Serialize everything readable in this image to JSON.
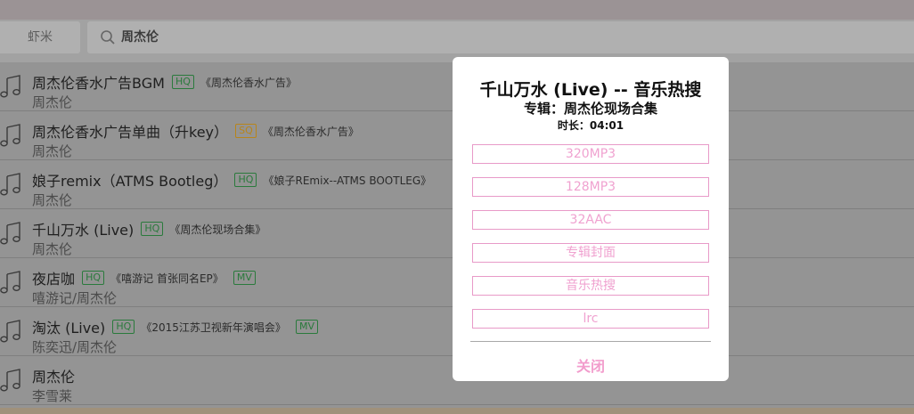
{
  "header": {
    "source_tab": "虾米",
    "search_query": "周杰伦"
  },
  "songs": [
    {
      "title": "周杰伦香水广告BGM",
      "quality": "HQ",
      "album": "《周杰伦香水广告》",
      "mv": "",
      "artist": "周杰伦"
    },
    {
      "title": "周杰伦香水广告单曲（升key）",
      "quality": "SQ",
      "album": "《周杰伦香水广告》",
      "mv": "",
      "artist": "周杰伦"
    },
    {
      "title": "娘子remix（ATMS Bootleg）",
      "quality": "HQ",
      "album": "《娘子REmix--ATMS BOOTLEG》",
      "mv": "",
      "artist": "周杰伦"
    },
    {
      "title": "千山万水 (Live)",
      "quality": "HQ",
      "album": "《周杰伦现场合集》",
      "mv": "",
      "artist": "周杰伦"
    },
    {
      "title": "夜店咖",
      "quality": "HQ",
      "album": "《嘻游记 首张同名EP》",
      "mv": "MV",
      "artist": "嘻游记/周杰伦"
    },
    {
      "title": "淘汰 (Live)",
      "quality": "HQ",
      "album": "《2015江苏卫视新年演唱会》",
      "mv": "MV",
      "artist": "陈奕迅/周杰伦"
    },
    {
      "title": "周杰伦",
      "quality": "",
      "album": "",
      "mv": "",
      "artist": "李雪莱"
    }
  ],
  "modal": {
    "title": "千山万水 (Live) -- 音乐热搜",
    "album_line": "专辑：周杰伦现场合集",
    "duration_line": "时长：04:01",
    "options": [
      "320MP3",
      "128MP3",
      "32AAC",
      "专辑封面",
      "音乐热搜",
      "lrc"
    ],
    "close_label": "关闭"
  },
  "colors": {
    "accent_pink": "#f0a2d0",
    "hq_green": "#2a7a3c",
    "sq_orange": "#b8851a"
  }
}
